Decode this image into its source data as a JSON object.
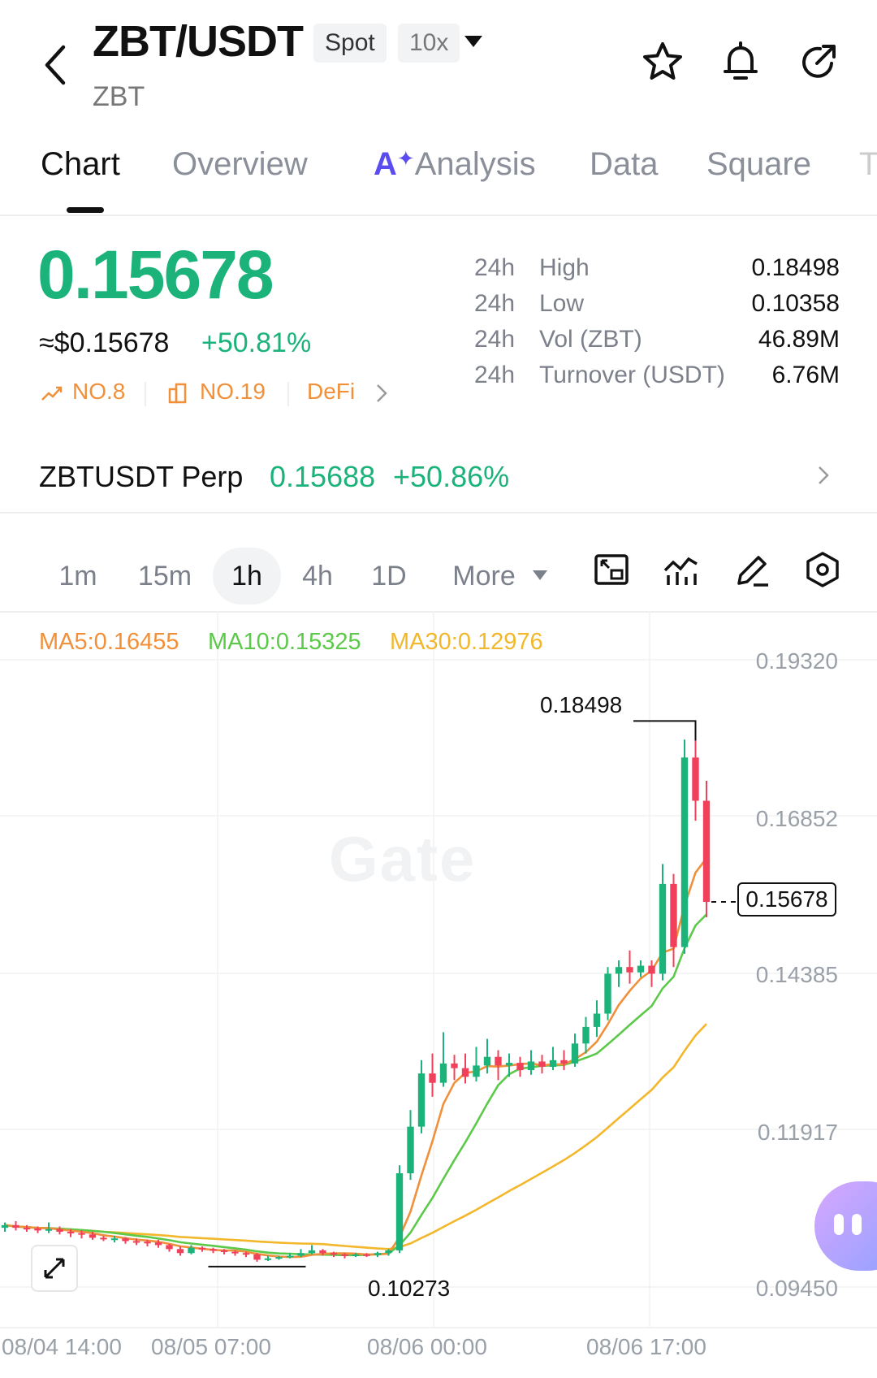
{
  "header": {
    "pair": "ZBT/USDT",
    "market_type": "Spot",
    "leverage": "10x",
    "base": "ZBT",
    "icons": [
      "back-arrow-icon",
      "star-icon",
      "bell-icon",
      "share-icon"
    ]
  },
  "tabs": [
    {
      "label": "Chart",
      "active": true
    },
    {
      "label": "Overview",
      "active": false
    },
    {
      "ai_prefix": "A",
      "label": "Analysis",
      "active": false
    },
    {
      "label": "Data",
      "active": false
    },
    {
      "label": "Square",
      "active": false
    },
    {
      "label": "T",
      "active": false
    }
  ],
  "price": {
    "last": "0.15678",
    "usd": "≈$0.15678",
    "change": "+50.81%",
    "ranks": [
      "NO.8",
      "NO.19",
      "DeFi"
    ]
  },
  "stats": [
    {
      "period": "24h",
      "label": "High",
      "value": "0.18498"
    },
    {
      "period": "24h",
      "label": "Low",
      "value": "0.10358"
    },
    {
      "period": "24h",
      "label": "Vol (ZBT)",
      "value": "46.89M"
    },
    {
      "period": "24h",
      "label": "Turnover (USDT)",
      "value": "6.76M"
    }
  ],
  "perp": {
    "name": "ZBTUSDT Perp",
    "price": "0.15688",
    "change": "+50.86%"
  },
  "intervals": [
    "1m",
    "15m",
    "1h",
    "4h",
    "1D"
  ],
  "more_label": "More",
  "active_interval": "1h",
  "colors": {
    "up": "#1bb37a",
    "down": "#f0405a",
    "rank": "#f0903a",
    "ma5": "#f0903a",
    "ma10": "#5cc94a",
    "ma30": "#f2b72b",
    "ai": "#5b4cf0"
  },
  "chart_data": {
    "type": "candlestick",
    "indicators": [
      {
        "label": "MA5:0.16455"
      },
      {
        "label": "MA10:0.15325"
      },
      {
        "label": "MA30:0.12976"
      }
    ],
    "ylabels": [
      "0.19320",
      "0.16852",
      "0.14385",
      "0.11917",
      "0.09450"
    ],
    "ylim": [
      0.0945,
      0.1932
    ],
    "xlabels": [
      "08/04 14:00",
      "08/05 07:00",
      "08/06 00:00",
      "08/06 17:00"
    ],
    "high_marker": "0.18498",
    "low_marker": "0.10273",
    "current_marker": "0.15678",
    "watermark": "Gate",
    "candles": [
      [
        0.1078,
        0.1082,
        0.1086,
        0.1072
      ],
      [
        0.1082,
        0.1078,
        0.1088,
        0.1074
      ],
      [
        0.1078,
        0.1077,
        0.1082,
        0.1072
      ],
      [
        0.1077,
        0.1074,
        0.108,
        0.107
      ],
      [
        0.1074,
        0.1076,
        0.1086,
        0.107
      ],
      [
        0.1076,
        0.1072,
        0.108,
        0.1068
      ],
      [
        0.1072,
        0.107,
        0.1076,
        0.1064
      ],
      [
        0.107,
        0.1068,
        0.1074,
        0.1062
      ],
      [
        0.1068,
        0.1063,
        0.1072,
        0.106
      ],
      [
        0.1063,
        0.1061,
        0.1066,
        0.1058
      ],
      [
        0.1061,
        0.1062,
        0.1066,
        0.1056
      ],
      [
        0.1062,
        0.1058,
        0.1064,
        0.1054
      ],
      [
        0.1058,
        0.1057,
        0.1062,
        0.1052
      ],
      [
        0.1057,
        0.1056,
        0.106,
        0.105
      ],
      [
        0.1056,
        0.1052,
        0.106,
        0.1048
      ],
      [
        0.1052,
        0.1046,
        0.1054,
        0.1042
      ],
      [
        0.1046,
        0.104,
        0.105,
        0.1036
      ],
      [
        0.104,
        0.1048,
        0.1052,
        0.1038
      ],
      [
        0.1048,
        0.1046,
        0.105,
        0.1042
      ],
      [
        0.1046,
        0.1044,
        0.1048,
        0.104
      ],
      [
        0.1044,
        0.1042,
        0.1046,
        0.1038
      ],
      [
        0.1042,
        0.104,
        0.1044,
        0.1036
      ],
      [
        0.104,
        0.1038,
        0.1042,
        0.1034
      ],
      [
        0.1038,
        0.103,
        0.104,
        0.1027
      ],
      [
        0.103,
        0.1032,
        0.1036,
        0.1028
      ],
      [
        0.1032,
        0.1034,
        0.1036,
        0.103
      ],
      [
        0.1034,
        0.1036,
        0.104,
        0.1032
      ],
      [
        0.1036,
        0.104,
        0.1046,
        0.1034
      ],
      [
        0.104,
        0.1044,
        0.1052,
        0.1038
      ],
      [
        0.1044,
        0.104,
        0.1046,
        0.1036
      ],
      [
        0.104,
        0.1038,
        0.1042,
        0.1034
      ],
      [
        0.1038,
        0.1036,
        0.104,
        0.1032
      ],
      [
        0.1036,
        0.1038,
        0.104,
        0.1034
      ],
      [
        0.1038,
        0.1037,
        0.104,
        0.1034
      ],
      [
        0.1037,
        0.104,
        0.1042,
        0.1034
      ],
      [
        0.104,
        0.1044,
        0.1046,
        0.1036
      ],
      [
        0.1044,
        0.116,
        0.1172,
        0.104
      ],
      [
        0.116,
        0.123,
        0.1255,
        0.115
      ],
      [
        0.123,
        0.131,
        0.133,
        0.122
      ],
      [
        0.131,
        0.1296,
        0.134,
        0.1275
      ],
      [
        0.1296,
        0.1325,
        0.1372,
        0.129
      ],
      [
        0.1325,
        0.1318,
        0.1338,
        0.13
      ],
      [
        0.1318,
        0.1305,
        0.134,
        0.1295
      ],
      [
        0.1305,
        0.1322,
        0.135,
        0.1298
      ],
      [
        0.1322,
        0.1335,
        0.1362,
        0.131
      ],
      [
        0.1335,
        0.1322,
        0.1345,
        0.13
      ],
      [
        0.1322,
        0.1326,
        0.134,
        0.1305
      ],
      [
        0.1326,
        0.1315,
        0.1335,
        0.1305
      ],
      [
        0.1315,
        0.1328,
        0.1345,
        0.1308
      ],
      [
        0.1328,
        0.132,
        0.1338,
        0.131
      ],
      [
        0.132,
        0.133,
        0.135,
        0.1315
      ],
      [
        0.133,
        0.1325,
        0.1345,
        0.1315
      ],
      [
        0.1325,
        0.1355,
        0.137,
        0.132
      ],
      [
        0.1355,
        0.138,
        0.1395,
        0.134
      ],
      [
        0.138,
        0.14,
        0.142,
        0.1365
      ],
      [
        0.14,
        0.146,
        0.147,
        0.139
      ],
      [
        0.146,
        0.147,
        0.148,
        0.144
      ],
      [
        0.147,
        0.1462,
        0.1495,
        0.1445
      ],
      [
        0.1462,
        0.1472,
        0.148,
        0.1455
      ],
      [
        0.1472,
        0.146,
        0.148,
        0.144
      ],
      [
        0.146,
        0.1595,
        0.1625,
        0.145
      ],
      [
        0.1595,
        0.15,
        0.161,
        0.147
      ],
      [
        0.15,
        0.1785,
        0.1812,
        0.149
      ],
      [
        0.1785,
        0.172,
        0.184,
        0.169
      ],
      [
        0.172,
        0.1568,
        0.175,
        0.1545
      ]
    ]
  }
}
